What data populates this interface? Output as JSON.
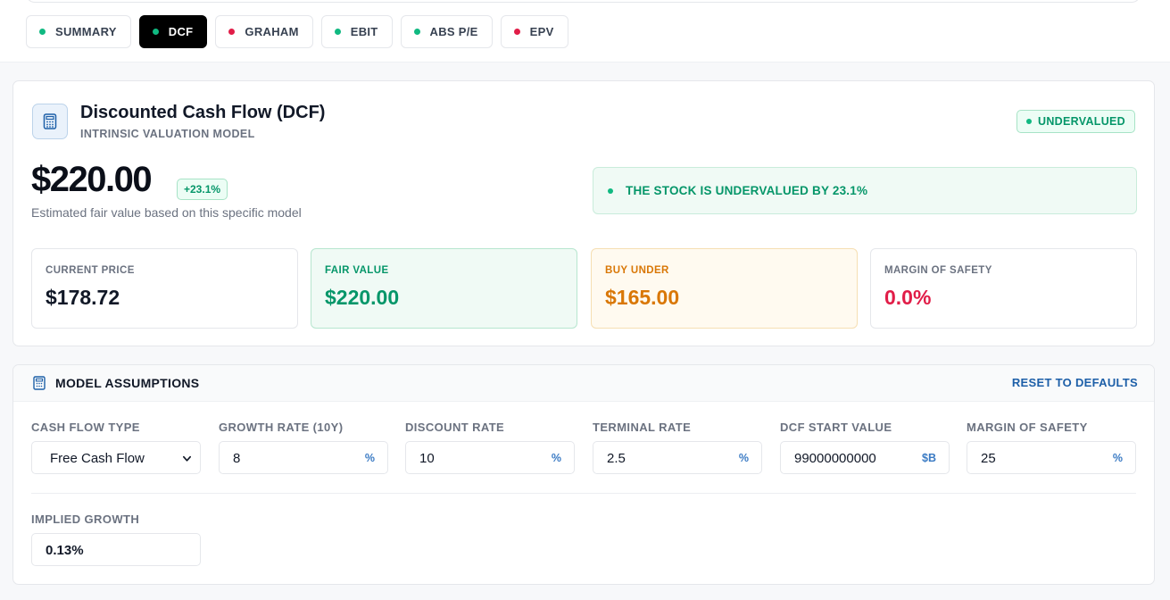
{
  "tabs": [
    {
      "label": "SUMMARY",
      "dot_color": "#10b981",
      "active": false
    },
    {
      "label": "DCF",
      "dot_color": "#10b981",
      "active": true
    },
    {
      "label": "GRAHAM",
      "dot_color": "#e11d48",
      "active": false
    },
    {
      "label": "EBIT",
      "dot_color": "#10b981",
      "active": false
    },
    {
      "label": "ABS P/E",
      "dot_color": "#10b981",
      "active": false
    },
    {
      "label": "EPV",
      "dot_color": "#e11d48",
      "active": false
    }
  ],
  "model": {
    "icon": "calculator-icon",
    "title": "Discounted Cash Flow (DCF)",
    "subtitle": "INTRINSIC VALUATION MODEL",
    "status": "UNDERVALUED",
    "fair_value": "$220.00",
    "upside": "+23.1%",
    "fair_value_note": "Estimated fair value based on this specific model",
    "verdict": "THE STOCK IS UNDERVALUED BY 23.1%"
  },
  "metrics": [
    {
      "label": "CURRENT PRICE",
      "value": "$178.72"
    },
    {
      "label": "FAIR VALUE",
      "value": "$220.00"
    },
    {
      "label": "BUY UNDER",
      "value": "$165.00"
    },
    {
      "label": "MARGIN OF SAFETY",
      "value": "0.0%"
    }
  ],
  "assumptions": {
    "title": "MODEL ASSUMPTIONS",
    "reset_label": "RESET TO DEFAULTS",
    "fields": [
      {
        "label": "CASH FLOW TYPE",
        "value": "Free Cash Flow",
        "unit": ""
      },
      {
        "label": "GROWTH RATE (10Y)",
        "value": "8",
        "unit": "%"
      },
      {
        "label": "DISCOUNT RATE",
        "value": "10",
        "unit": "%"
      },
      {
        "label": "TERMINAL RATE",
        "value": "2.5",
        "unit": "%"
      },
      {
        "label": "DCF START VALUE",
        "value": "99000000000",
        "unit": "$B"
      },
      {
        "label": "MARGIN OF SAFETY",
        "value": "25",
        "unit": "%"
      }
    ],
    "implied_label": "IMPLIED GROWTH",
    "implied_value": "0.13%"
  },
  "colors": {
    "accent_green": "#059669",
    "accent_orange": "#d97706",
    "accent_red": "#e11d48",
    "link_blue": "#1d5fa8"
  }
}
